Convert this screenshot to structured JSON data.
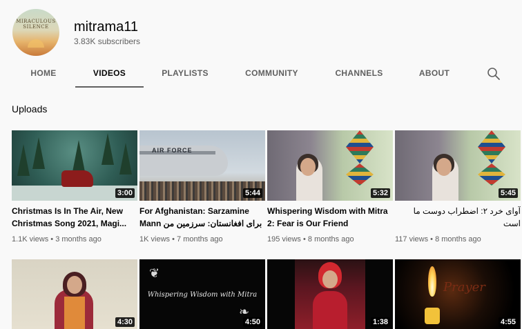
{
  "channel": {
    "avatar_text": "MIRACULOUS SILENCE",
    "name": "mitrama11",
    "subscribers": "3.83K subscribers"
  },
  "tabs": [
    {
      "label": "HOME",
      "active": false
    },
    {
      "label": "VIDEOS",
      "active": true
    },
    {
      "label": "PLAYLISTS",
      "active": false
    },
    {
      "label": "COMMUNITY",
      "active": false
    },
    {
      "label": "CHANNELS",
      "active": false
    },
    {
      "label": "ABOUT",
      "active": false
    }
  ],
  "search_icon": "search-icon",
  "section_title": "Uploads",
  "videos": [
    {
      "title": "Christmas Is In The Air, New Christmas Song 2021, Magi...",
      "duration": "3:00",
      "views": "1.1K views",
      "age": "3 months ago"
    },
    {
      "title": "For Afghanistan: Sarzamine Mann برای افغانستان: سرزمین من",
      "duration": "5:44",
      "views": "1K views",
      "age": "7 months ago"
    },
    {
      "title": "Whispering Wisdom with Mitra 2: Fear is Our Friend",
      "duration": "5:32",
      "views": "195 views",
      "age": "8 months ago"
    },
    {
      "title": "آوای خرد ۲: اضطراب دوست ما است",
      "duration": "5:45",
      "views": "117 views",
      "age": "8 months ago"
    },
    {
      "title": "",
      "duration": "4:30",
      "views": "",
      "age": ""
    },
    {
      "title": "",
      "duration": "4:50",
      "views": "",
      "age": "",
      "thumb_text": "Whispering Wisdom with Mitra"
    },
    {
      "title": "",
      "duration": "1:38",
      "views": "",
      "age": ""
    },
    {
      "title": "",
      "duration": "4:55",
      "views": "",
      "age": "",
      "thumb_text": "Prayer"
    }
  ],
  "separator": "•"
}
